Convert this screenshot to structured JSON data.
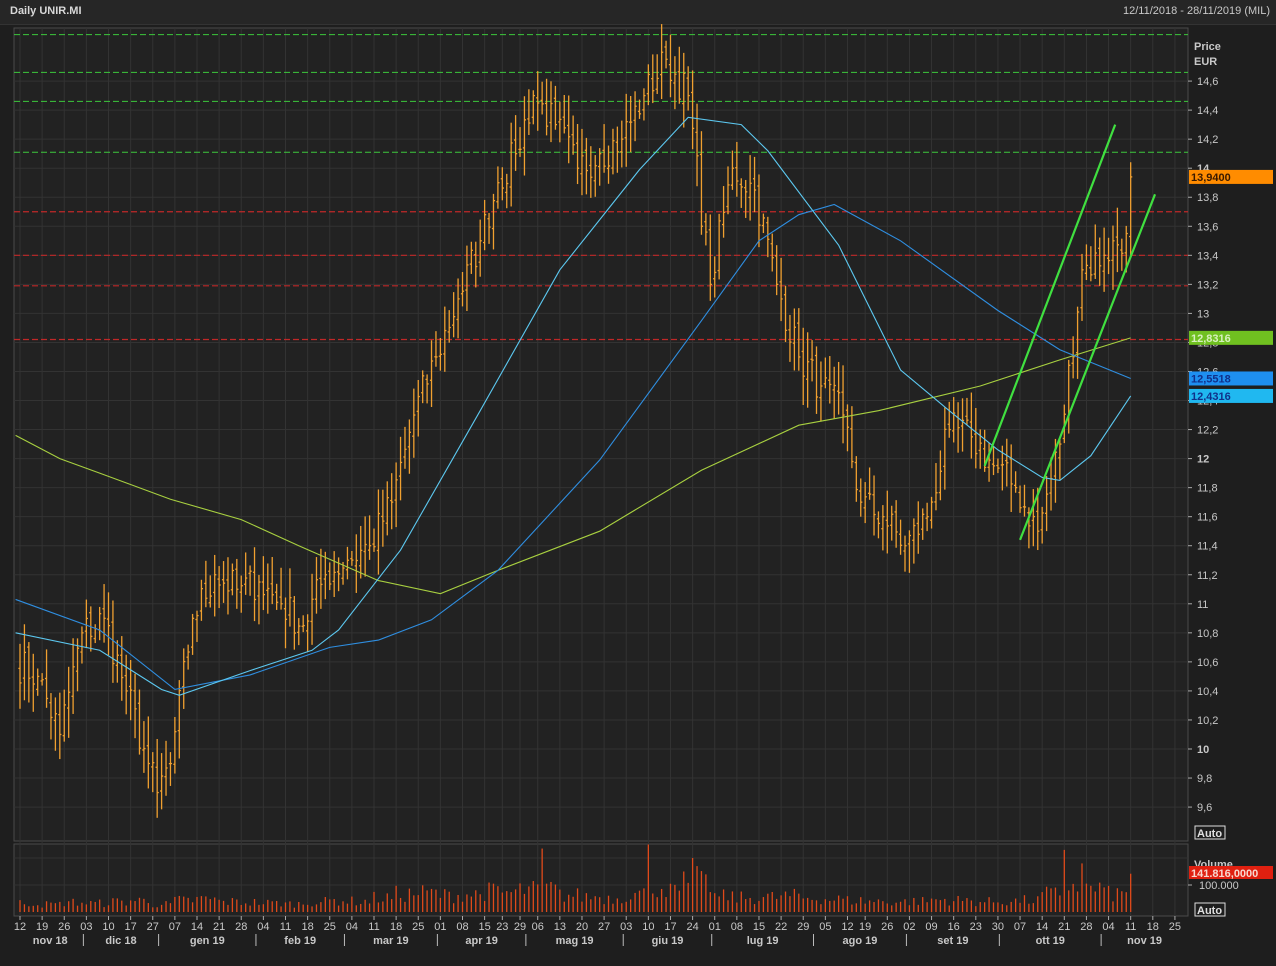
{
  "header": {
    "title": "Daily UNIR.MI",
    "range": "12/11/2018 - 28/11/2019 (MIL)"
  },
  "chart_data": {
    "type": "ohlc",
    "symbol": "UNIR.MI",
    "start_date": "2018-11-12",
    "last_bar_date": "2019-11-11",
    "axis_end_date": "2019-11-29",
    "holidays": [
      "2018-12-24",
      "2018-12-25",
      "2018-12-26",
      "2018-12-31",
      "2019-01-01",
      "2019-04-19",
      "2019-04-22",
      "2019-05-01",
      "2019-08-15"
    ],
    "price_axis": {
      "title": "Price",
      "unit": "EUR",
      "ylim": [
        9.45,
        15.0
      ],
      "step": 0.2,
      "labels": [
        "14,6",
        "14,4",
        "14,2",
        "14",
        "13,8",
        "13,6",
        "13,4",
        "13,2",
        "13",
        "12,8",
        "12,6",
        "12,4",
        "12,2",
        "12",
        "11,8",
        "11,6",
        "11,4",
        "11,2",
        "11",
        "10,8",
        "10,6",
        "10,4",
        "10,2",
        "10",
        "9,8",
        "9,6"
      ],
      "values": [
        14.6,
        14.4,
        14.2,
        14.0,
        13.8,
        13.6,
        13.4,
        13.2,
        13.0,
        12.8,
        12.6,
        12.4,
        12.2,
        12.0,
        11.8,
        11.6,
        11.4,
        11.2,
        11.0,
        10.8,
        10.6,
        10.4,
        10.2,
        10.0,
        9.8,
        9.6
      ],
      "auto_label": "Auto"
    },
    "weekly_close": [
      10.5,
      10.1,
      10.8,
      10.9,
      10.4,
      9.9,
      9.7,
      9.9,
      10.9,
      11.2,
      11.1,
      11.15,
      11.0,
      10.85,
      11.2,
      11.3,
      11.4,
      11.7,
      12.3,
      12.7,
      13.1,
      13.5,
      13.9,
      14.1,
      14.5,
      14.3,
      14.0,
      14.1,
      14.2,
      14.5,
      14.75,
      14.5,
      13.2,
      14.0,
      13.85,
      13.2,
      12.7,
      12.5,
      12.3,
      11.7,
      11.6,
      11.4,
      11.6,
      12.2,
      12.15,
      11.95,
      11.8,
      11.5,
      12.1,
      13.3,
      13.4,
      13.55,
      13.94
    ],
    "last_price": {
      "value": 13.94,
      "label": "13,9400",
      "color": "#ff8c00"
    },
    "moving_averages": [
      {
        "name": "MA long",
        "color": "#a8d040",
        "label": "12,8316",
        "last": 12.8316,
        "points": [
          [
            -1,
            12.16
          ],
          [
            9,
            12.0
          ],
          [
            18,
            11.9
          ],
          [
            34,
            11.72
          ],
          [
            50,
            11.58
          ],
          [
            63,
            11.4
          ],
          [
            81,
            11.16
          ],
          [
            95,
            11.07
          ],
          [
            108,
            11.23
          ],
          [
            131,
            11.5
          ],
          [
            154,
            11.92
          ],
          [
            176,
            12.23
          ],
          [
            194,
            12.33
          ],
          [
            217,
            12.5
          ],
          [
            235,
            12.68
          ],
          [
            251,
            12.8316
          ]
        ]
      },
      {
        "name": "MA medium",
        "color": "#2f8ee0",
        "label": "12,5518",
        "last": 12.5518,
        "points": [
          [
            -1,
            11.03
          ],
          [
            18,
            10.82
          ],
          [
            35,
            10.41
          ],
          [
            52,
            10.51
          ],
          [
            70,
            10.7
          ],
          [
            81,
            10.75
          ],
          [
            93,
            10.89
          ],
          [
            108,
            11.23
          ],
          [
            131,
            11.99
          ],
          [
            154,
            12.95
          ],
          [
            167,
            13.5
          ],
          [
            176,
            13.68
          ],
          [
            184,
            13.75
          ],
          [
            199,
            13.5
          ],
          [
            221,
            13.02
          ],
          [
            235,
            12.75
          ],
          [
            251,
            12.5518
          ]
        ]
      },
      {
        "name": "MA short",
        "color": "#5cc8f0",
        "label": "12,4316",
        "last": 12.4316,
        "points": [
          [
            -1,
            10.8
          ],
          [
            18,
            10.68
          ],
          [
            32,
            10.41
          ],
          [
            36,
            10.37
          ],
          [
            52,
            10.54
          ],
          [
            66,
            10.68
          ],
          [
            72,
            10.82
          ],
          [
            86,
            11.37
          ],
          [
            104,
            12.33
          ],
          [
            122,
            13.3
          ],
          [
            140,
            13.99
          ],
          [
            151,
            14.35
          ],
          [
            163,
            14.3
          ],
          [
            169,
            14.12
          ],
          [
            185,
            13.47
          ],
          [
            199,
            12.61
          ],
          [
            210,
            12.33
          ],
          [
            221,
            12.06
          ],
          [
            231,
            11.87
          ],
          [
            235,
            11.85
          ],
          [
            242,
            12.02
          ],
          [
            251,
            12.4316
          ]
        ]
      }
    ],
    "levels_green": [
      14.92,
      14.66,
      14.46,
      14.11
    ],
    "levels_red": [
      13.7,
      13.4,
      13.19,
      12.82
    ],
    "trend_lines": [
      [
        [
          218,
          11.95
        ],
        [
          247.5,
          14.3
        ]
      ],
      [
        [
          226,
          11.44
        ],
        [
          256.5,
          13.82
        ]
      ]
    ],
    "volume": {
      "title": "Volume",
      "last_label": "141.816,0000",
      "last": 141.816,
      "tick_label": "100.000",
      "tick_value": 100,
      "unit": "thousands",
      "auto_label": "Auto",
      "weekly_base": [
        35,
        30,
        38,
        34,
        40,
        45,
        30,
        30,
        45,
        50,
        40,
        38,
        35,
        32,
        40,
        45,
        42,
        55,
        70,
        75,
        65,
        70,
        80,
        75,
        85,
        90,
        65,
        60,
        55,
        70,
        100,
        80,
        110,
        60,
        55,
        58,
        62,
        55,
        50,
        45,
        42,
        40,
        42,
        48,
        45,
        40,
        42,
        45,
        70,
        110,
        90,
        70,
        141.816
      ],
      "spikes": [
        [
          "2019-05-07",
          235
        ],
        [
          "2019-06-10",
          250
        ],
        [
          "2019-06-20",
          150
        ],
        [
          "2019-06-24",
          200
        ],
        [
          "2019-06-25",
          170
        ],
        [
          "2019-10-21",
          230
        ],
        [
          "2019-10-25",
          180
        ],
        [
          "2019-11-11",
          141.816
        ]
      ]
    },
    "x_ticks": [
      [
        "12",
        "2018-11-12"
      ],
      [
        "19",
        "2018-11-19"
      ],
      [
        "26",
        "2018-11-26"
      ],
      [
        "03",
        "2018-12-03"
      ],
      [
        "10",
        "2018-12-10"
      ],
      [
        "17",
        "2018-12-17"
      ],
      [
        "27",
        "2018-12-27"
      ],
      [
        "07",
        "2019-01-07"
      ],
      [
        "14",
        "2019-01-14"
      ],
      [
        "21",
        "2019-01-21"
      ],
      [
        "28",
        "2019-01-28"
      ],
      [
        "04",
        "2019-02-04"
      ],
      [
        "11",
        "2019-02-11"
      ],
      [
        "18",
        "2019-02-18"
      ],
      [
        "25",
        "2019-02-25"
      ],
      [
        "04",
        "2019-03-04"
      ],
      [
        "11",
        "2019-03-11"
      ],
      [
        "18",
        "2019-03-18"
      ],
      [
        "25",
        "2019-03-25"
      ],
      [
        "01",
        "2019-04-01"
      ],
      [
        "08",
        "2019-04-08"
      ],
      [
        "15",
        "2019-04-15"
      ],
      [
        "23",
        "2019-04-23"
      ],
      [
        "29",
        "2019-04-29"
      ],
      [
        "06",
        "2019-05-06"
      ],
      [
        "13",
        "2019-05-13"
      ],
      [
        "20",
        "2019-05-20"
      ],
      [
        "27",
        "2019-05-27"
      ],
      [
        "03",
        "2019-06-03"
      ],
      [
        "10",
        "2019-06-10"
      ],
      [
        "17",
        "2019-06-17"
      ],
      [
        "24",
        "2019-06-24"
      ],
      [
        "01",
        "2019-07-01"
      ],
      [
        "08",
        "2019-07-08"
      ],
      [
        "15",
        "2019-07-15"
      ],
      [
        "22",
        "2019-07-22"
      ],
      [
        "29",
        "2019-07-29"
      ],
      [
        "05",
        "2019-08-05"
      ],
      [
        "12",
        "2019-08-12"
      ],
      [
        "19",
        "2019-08-19"
      ],
      [
        "26",
        "2019-08-26"
      ],
      [
        "02",
        "2019-09-02"
      ],
      [
        "09",
        "2019-09-09"
      ],
      [
        "16",
        "2019-09-16"
      ],
      [
        "23",
        "2019-09-23"
      ],
      [
        "30",
        "2019-09-30"
      ],
      [
        "07",
        "2019-10-07"
      ],
      [
        "14",
        "2019-10-14"
      ],
      [
        "21",
        "2019-10-21"
      ],
      [
        "28",
        "2019-10-28"
      ],
      [
        "04",
        "2019-11-04"
      ],
      [
        "11",
        "2019-11-11"
      ],
      [
        "18",
        "2019-11-18"
      ],
      [
        "25",
        "2019-11-25"
      ]
    ],
    "months": [
      [
        "nov 18",
        "2018-11-12"
      ],
      [
        "dic 18",
        "2018-12-03"
      ],
      [
        "gen 19",
        "2019-01-02"
      ],
      [
        "feb 19",
        "2019-02-01"
      ],
      [
        "mar 19",
        "2019-03-01"
      ],
      [
        "apr 19",
        "2019-04-01"
      ],
      [
        "mag 19",
        "2019-05-02"
      ],
      [
        "giu 19",
        "2019-06-03"
      ],
      [
        "lug 19",
        "2019-07-01"
      ],
      [
        "ago 19",
        "2019-08-01"
      ],
      [
        "set 19",
        "2019-09-02"
      ],
      [
        "ott 19",
        "2019-10-01"
      ],
      [
        "nov 19",
        "2019-11-01"
      ]
    ],
    "colors": {
      "bars": "#f0a030",
      "volume": "#e04a1a",
      "grid": "#333333",
      "level_green": "#3cc83c",
      "level_red": "#c02828",
      "trend": "#40e040"
    }
  }
}
